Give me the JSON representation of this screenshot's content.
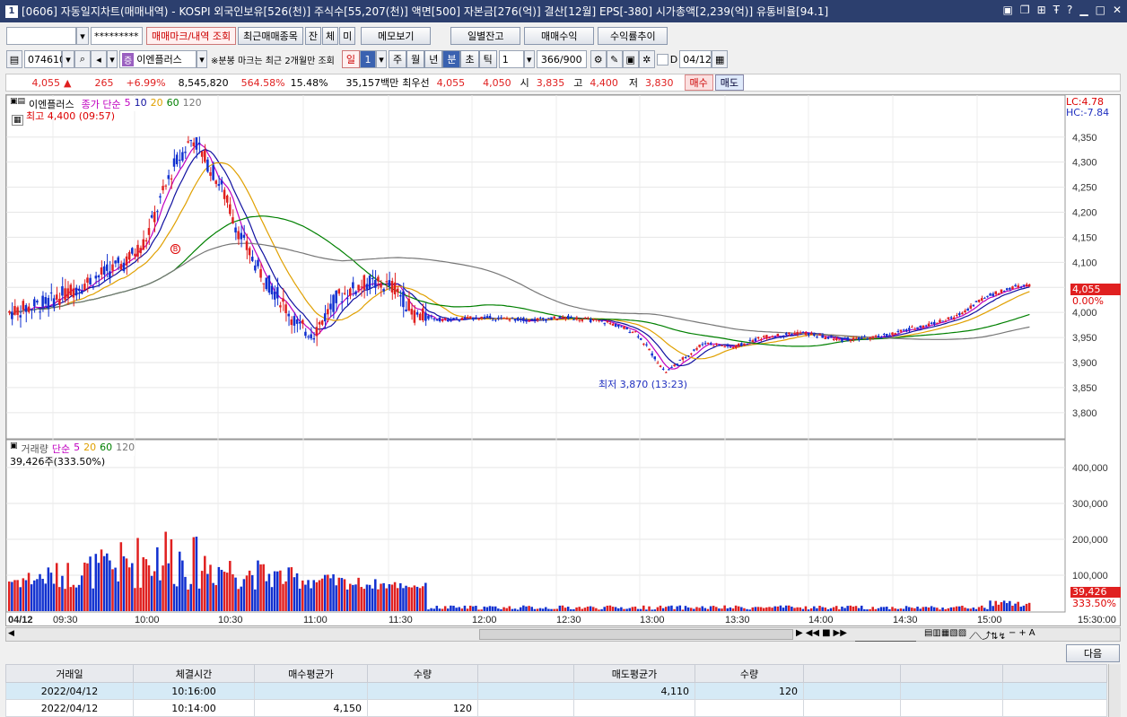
{
  "title": {
    "num": "1",
    "text": "[0606] 자동일지차트(매매내역) - KOSPI 외국인보유[526(천)] 주식수[55,207(천)] 액면[500] 자본금[276(억)] 결산[12월] EPS[-380] 시가총액[2,239(억)] 유통비율[94.1]",
    "controls": [
      "▣",
      "❐",
      "⊞",
      "Ŧ",
      "?",
      "▁",
      "□",
      "✕"
    ]
  },
  "toolbar": {
    "account": "",
    "password": "*********",
    "btn_trade_mark": "매매마크/내역 조회",
    "btn_recent": "최근매매종목",
    "btn_jan": "잔",
    "btn_che": "체",
    "btn_mi": "미",
    "btn_memo": "메모보기",
    "btn_daily": "일별잔고",
    "btn_profit": "매매수익",
    "btn_rate": "수익률추이"
  },
  "toolbar2": {
    "code": "074610",
    "name": "이엔플러스",
    "name_tag": "증",
    "notice": "※분봉 마크는 최근 2개월만 조회",
    "period_day": "일",
    "period_value": "1",
    "periods": [
      "주",
      "월",
      "년",
      "분",
      "초",
      "틱"
    ],
    "tick_value": "1",
    "count": "366/900",
    "date_check": "D",
    "date": "04/12"
  },
  "quote": {
    "price": "4,055",
    "arrow": "▲",
    "change": "265",
    "change_pct": "+6.99%",
    "volume": "8,545,820",
    "vol_ratio": "564.58%",
    "turnover": "15.48%",
    "amount": "35,157백만",
    "label_best": "최우선",
    "best_ask": "4,055",
    "best_bid": "4,050",
    "label_open": "시",
    "open": "3,835",
    "label_high": "고",
    "high": "4,400",
    "label_low": "저",
    "low": "3,830",
    "buy": "매수",
    "sell": "매도"
  },
  "chart": {
    "stock": "이엔플러스",
    "ma_label": "종가 단순",
    "ma_periods": [
      "5",
      "10",
      "20",
      "60",
      "120"
    ],
    "ma_colors": [
      "#c000c0",
      "#1010a0",
      "#e0a000",
      "#008000",
      "#777777"
    ],
    "high_label": "최고 4,400 (09:57)",
    "low_label": "최저 3,870 (13:23)",
    "lc": "LC:4.78",
    "hc": "HC:-7.84",
    "price_ticks": [
      "4,350",
      "4,300",
      "4,250",
      "4,200",
      "4,150",
      "4,100",
      "4,050",
      "4,000",
      "3,950",
      "3,900",
      "3,850",
      "3,800"
    ],
    "cur_price": "4,055",
    "cur_pct": "0.00%",
    "buy_mark": "B",
    "vol_title": "거래량",
    "vol_ma": "단순",
    "vol_ma_periods": [
      "5",
      "20",
      "60",
      "120"
    ],
    "vol_info": "39,426주(333.50%)",
    "vol_ticks": [
      "400,000",
      "300,000",
      "200,000",
      "100,000"
    ],
    "cur_vol": "39,426",
    "cur_vol_pct": "333.50%",
    "time_ticks": [
      "04/12",
      "09:30",
      "10:00",
      "10:30",
      "11:00",
      "11:30",
      "12:00",
      "12:30",
      "13:00",
      "13:30",
      "14:00",
      "14:30",
      "15:00",
      "15:30:00"
    ],
    "colors": {
      "up": "#e02020",
      "down": "#1030d0"
    }
  },
  "bottom": {
    "next": "다음",
    "headers": [
      "거래일",
      "체결시간",
      "매수평균가",
      "수량",
      "",
      "매도평균가",
      "수량"
    ],
    "rows": [
      [
        "2022/04/12",
        "10:16:00",
        "",
        "",
        "",
        "4,110",
        "120"
      ],
      [
        "2022/04/12",
        "10:14:00",
        "4,150",
        "120",
        "",
        "",
        ""
      ]
    ]
  }
}
